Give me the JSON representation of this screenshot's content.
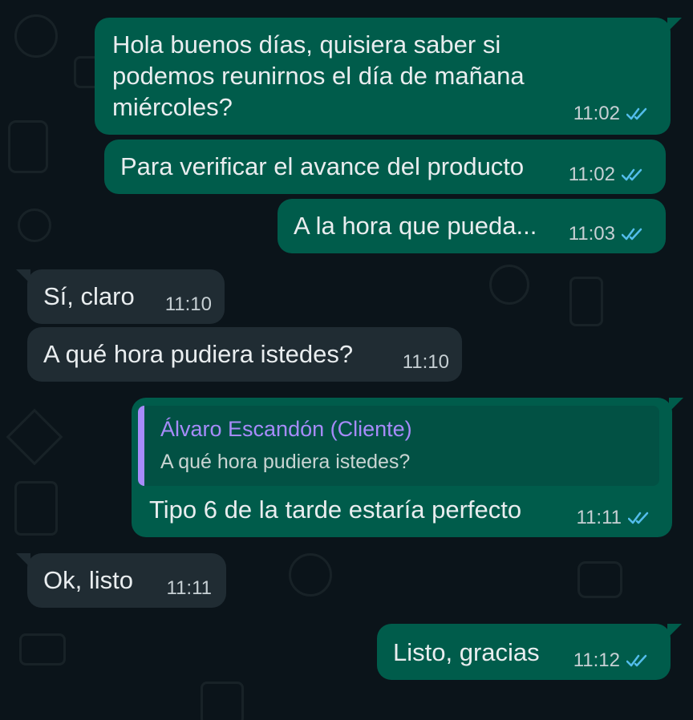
{
  "theme": {
    "background": "#0b141a",
    "outgoing_bubble": "#005c4b",
    "incoming_bubble": "#202c33",
    "reply_accent": "#a78bfa",
    "read_ticks": "#53bdeb"
  },
  "messages": [
    {
      "text": "Hola buenos días, quisiera saber si\npodemos reunirnos el día de mañana\nmiércoles?",
      "time": "11:02",
      "direction": "out"
    },
    {
      "text": "Para verificar el avance del producto",
      "time": "11:02",
      "direction": "out"
    },
    {
      "text": "A la hora que pueda...",
      "time": "11:03",
      "direction": "out"
    },
    {
      "text": "Sí, claro",
      "time": "11:10",
      "direction": "in"
    },
    {
      "text": "A qué hora pudiera istedes?",
      "time": "11:10",
      "direction": "in"
    },
    {
      "reply_to": {
        "author": "Álvaro Escandón (Cliente)",
        "text": "A qué hora pudiera istedes?"
      },
      "text": "Tipo 6 de la tarde estaría perfecto",
      "time": "11:11",
      "direction": "out"
    },
    {
      "text": "Ok, listo",
      "time": "11:11",
      "direction": "in"
    },
    {
      "text": "Listo, gracias",
      "time": "11:12",
      "direction": "out"
    }
  ]
}
